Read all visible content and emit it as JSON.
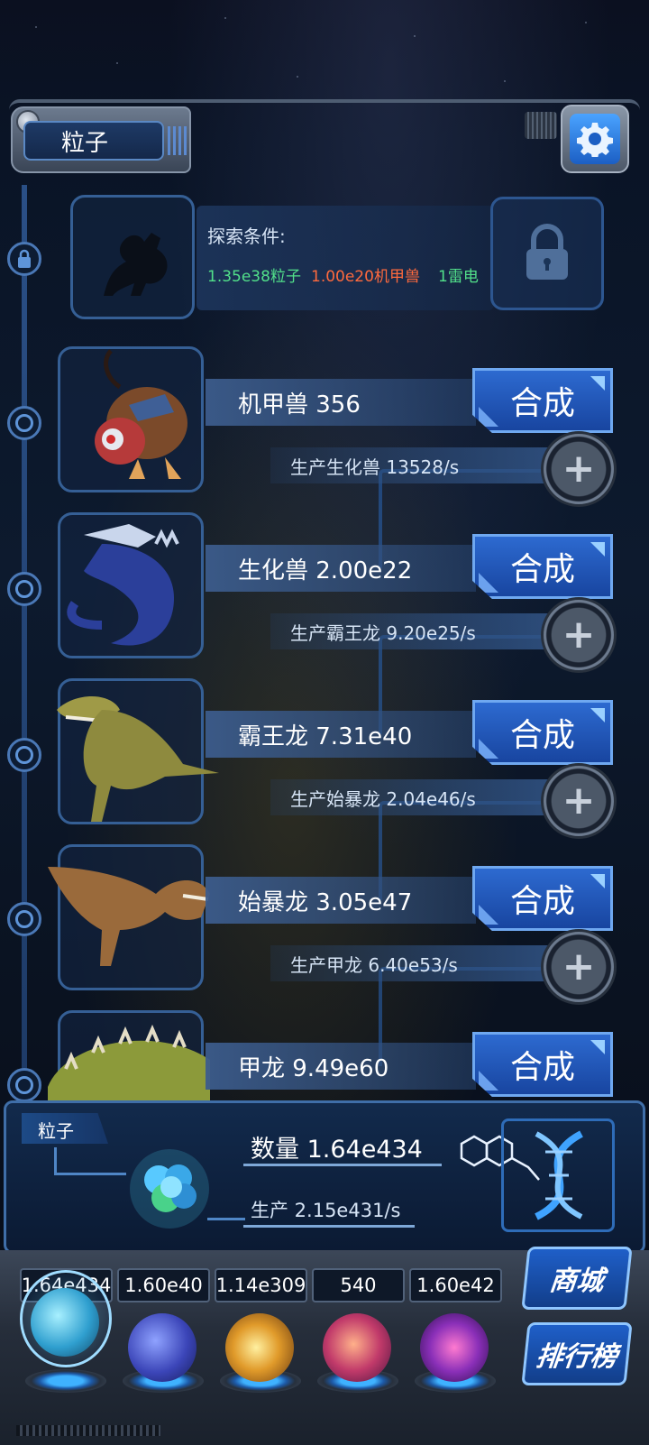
{
  "header": {
    "title": "粒子"
  },
  "locked_unit": {
    "explore_label": "探索条件:",
    "conditions": [
      {
        "text": "1.35e38粒子",
        "color": "#52e08a"
      },
      {
        "text": "1.00e20机甲兽",
        "color": "#ff6a3d"
      },
      {
        "text": "1雷电",
        "color": "#52e08a"
      }
    ]
  },
  "units": [
    {
      "name": "机甲兽 356",
      "produce": "生产生化兽 13528/s",
      "button": "合成"
    },
    {
      "name": "生化兽 2.00e22",
      "produce": "生产霸王龙 9.20e25/s",
      "button": "合成"
    },
    {
      "name": "霸王龙 7.31e40",
      "produce": "生产始暴龙 2.04e46/s",
      "button": "合成"
    },
    {
      "name": "始暴龙 3.05e47",
      "produce": "生产甲龙 6.40e53/s",
      "button": "合成"
    },
    {
      "name": "甲龙 9.49e60",
      "produce": "",
      "button": "合成"
    }
  ],
  "info_panel": {
    "tab_label": "粒子",
    "count_label": "数量 1.64e434",
    "production_label": "生产 2.15e431/s"
  },
  "resources": [
    {
      "value": "1.64e434",
      "icon": "particle-orb-icon"
    },
    {
      "value": "1.60e40",
      "icon": "lightning-orb-icon"
    },
    {
      "value": "1.14e309",
      "icon": "fire-orb-icon"
    },
    {
      "value": "540",
      "icon": "brain-orb-icon"
    },
    {
      "value": "1.60e42",
      "icon": "vortex-orb-icon"
    }
  ],
  "side_buttons": {
    "shop": "商城",
    "ranking": "排行榜"
  },
  "colors": {
    "accent": "#2d6ad0",
    "green_text": "#52e08a",
    "orange_text": "#ff6a3d"
  }
}
